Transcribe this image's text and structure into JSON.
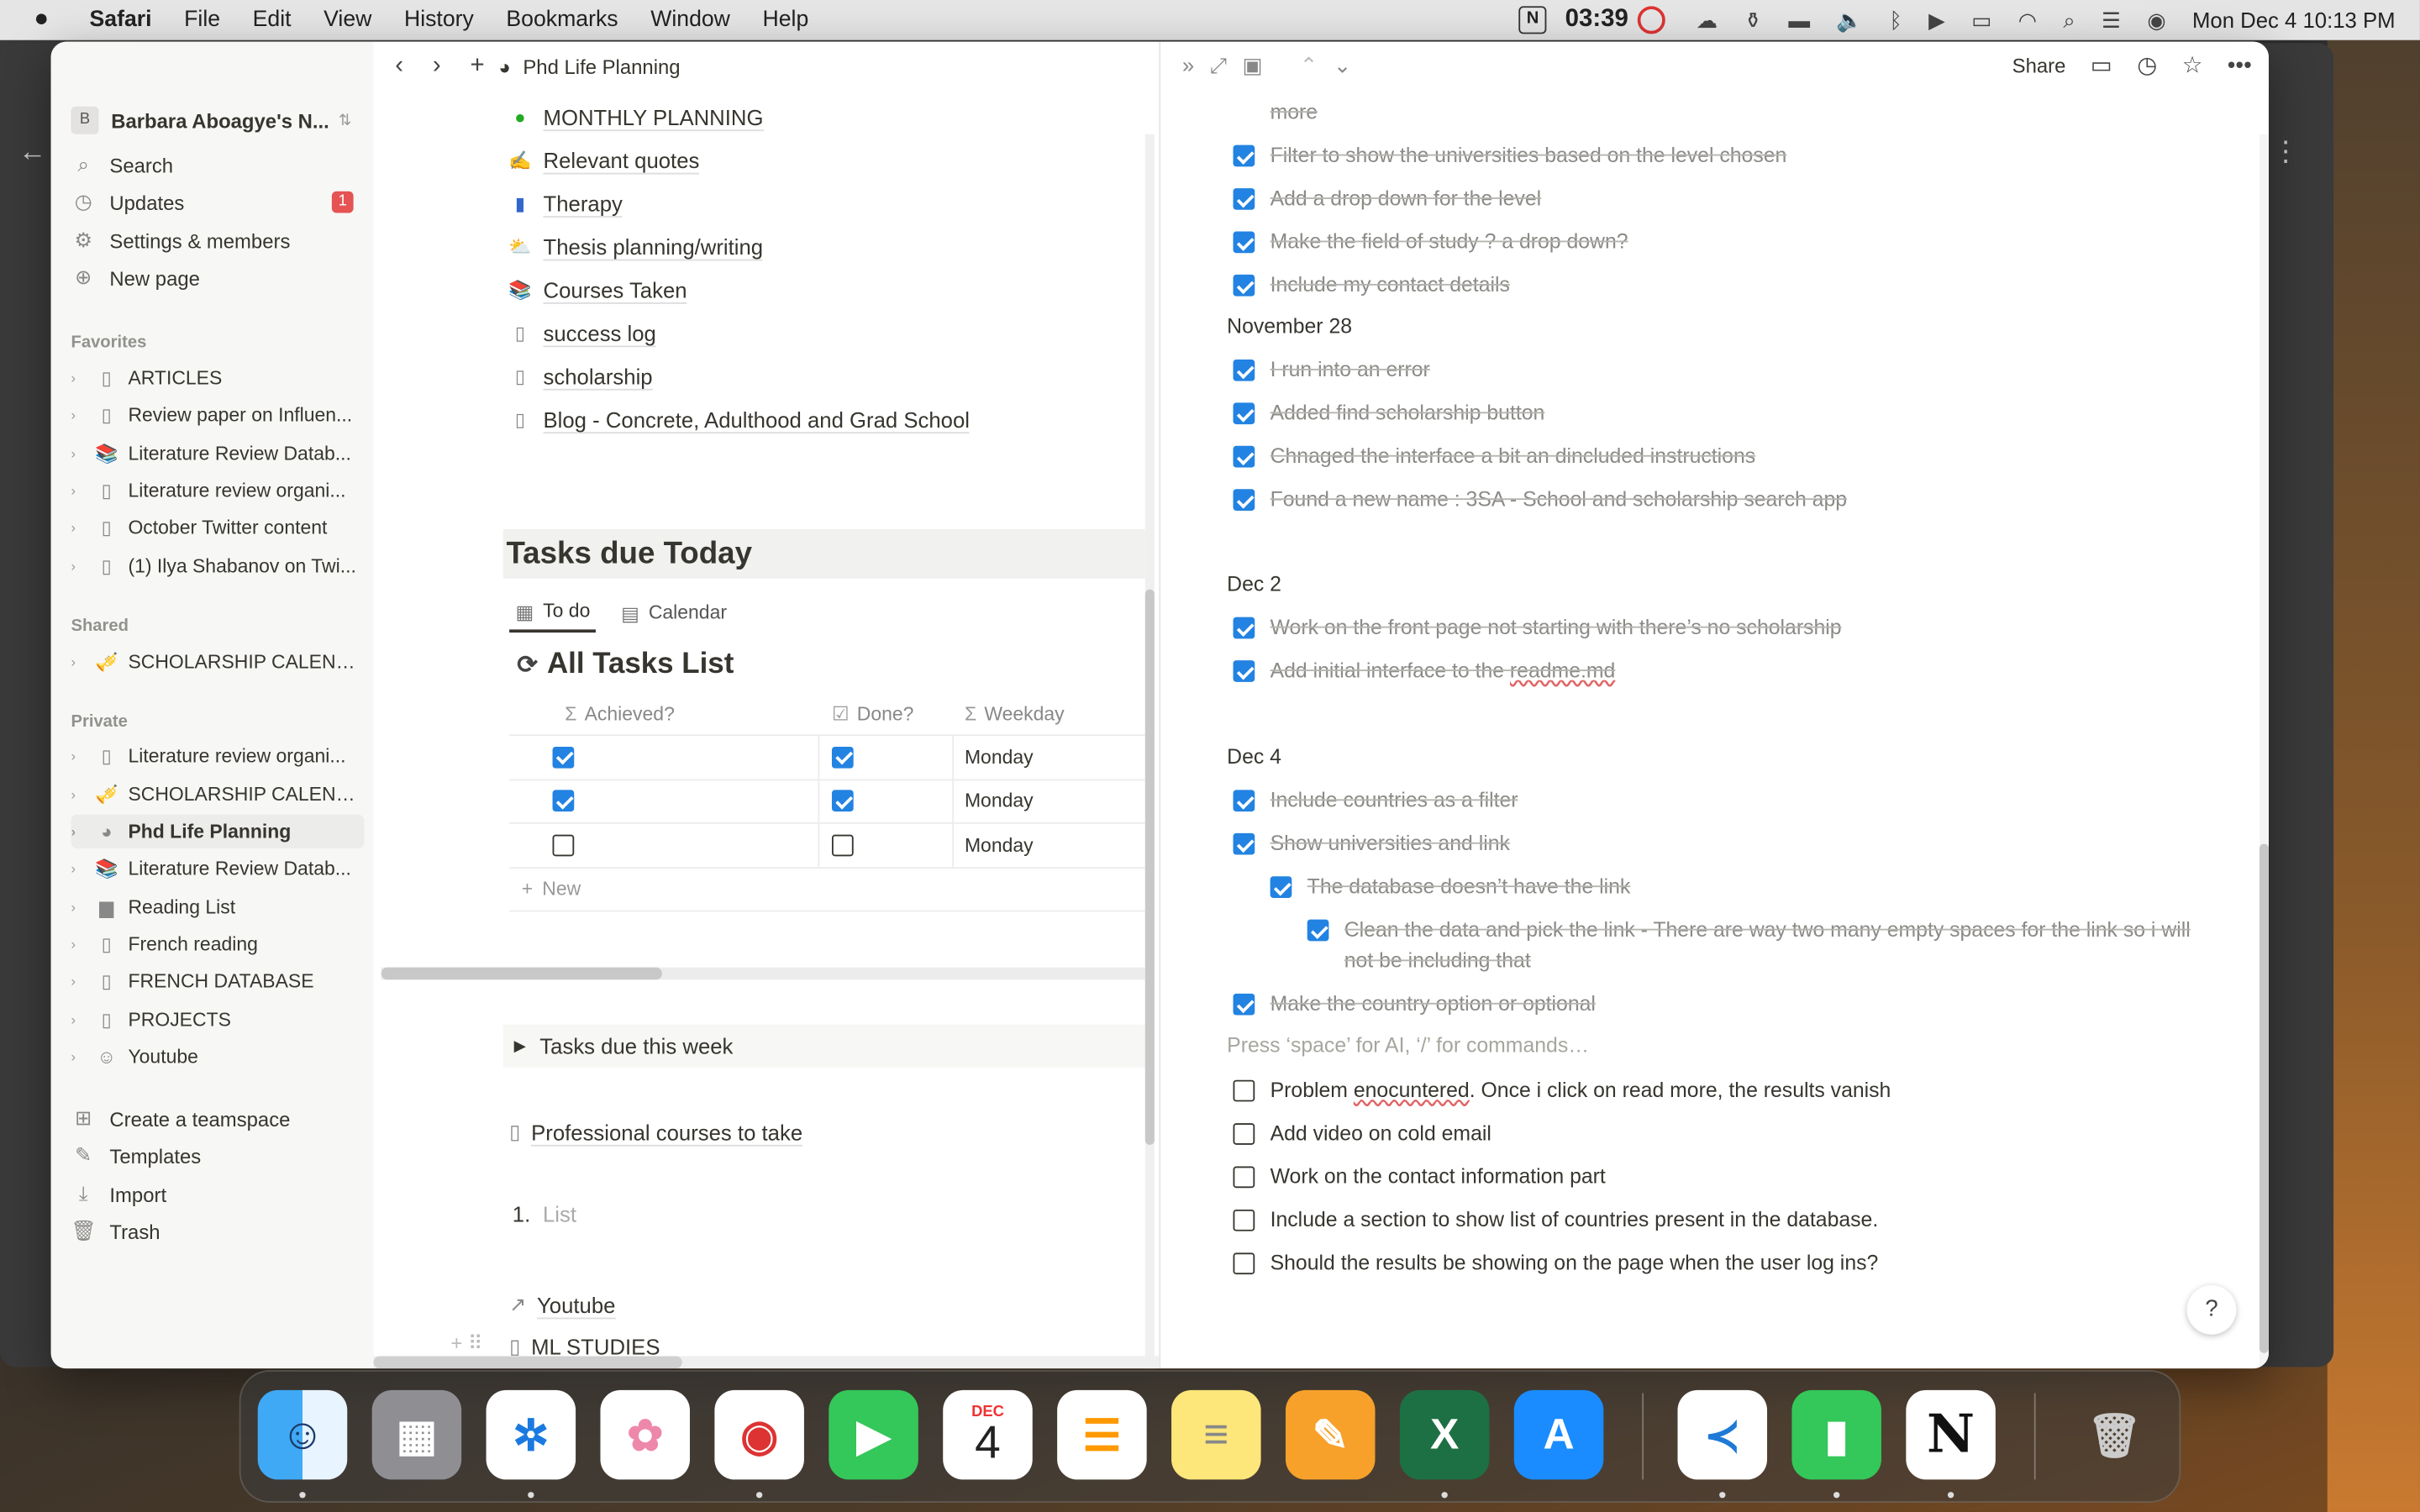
{
  "menubar": {
    "app": "Safari",
    "items": [
      "File",
      "Edit",
      "View",
      "History",
      "Bookmarks",
      "Window",
      "Help"
    ],
    "time": "03:39",
    "date": "Mon Dec 4  10:13 PM"
  },
  "sidebar": {
    "workspace": "Barbara Aboagye's N...",
    "workspace_initial": "B",
    "nav": [
      {
        "label": "Search",
        "icon": "search-icon"
      },
      {
        "label": "Updates",
        "icon": "clock-icon",
        "badge": "1"
      },
      {
        "label": "Settings & members",
        "icon": "gear-icon"
      },
      {
        "label": "New page",
        "icon": "plus-circle-icon"
      }
    ],
    "favorites_heading": "Favorites",
    "favorites": [
      "ARTICLES",
      "Review paper on Influen...",
      "Literature Review Datab...",
      "Literature review organi...",
      "October Twitter content",
      "(1) Ilya Shabanov on Twi..."
    ],
    "shared_heading": "Shared",
    "shared": [
      "SCHOLARSHIP CALEND..."
    ],
    "private_heading": "Private",
    "private": [
      "Literature review organi...",
      "SCHOLARSHIP CALEND...",
      "Phd Life Planning",
      "Literature Review Datab...",
      "Reading List",
      "French reading",
      "FRENCH DATABASE",
      "PROJECTS",
      "Youtube"
    ],
    "bottom": [
      {
        "label": "Create a teamspace",
        "icon": "teamspace-icon"
      },
      {
        "label": "Templates",
        "icon": "templates-icon"
      },
      {
        "label": "Import",
        "icon": "import-icon"
      },
      {
        "label": "Trash",
        "icon": "trash-icon"
      }
    ]
  },
  "left": {
    "page_title": "Phd Life Planning",
    "links": [
      "MONTHLY PLANNING",
      "Relevant quotes",
      "Therapy",
      "Thesis planning/writing",
      "Courses Taken",
      "success log",
      "scholarship",
      "Blog - Concrete, Adulthood and Grad School"
    ],
    "tasks_heading": "Tasks due Today",
    "tabs": [
      "To do",
      "Calendar"
    ],
    "db_title": "All Tasks List",
    "columns": [
      "Achieved?",
      "Done?",
      "Weekday"
    ],
    "rows": [
      {
        "achieved": true,
        "done": true,
        "weekday": "Monday"
      },
      {
        "achieved": true,
        "done": true,
        "weekday": "Monday"
      },
      {
        "achieved": false,
        "done": false,
        "weekday": "Monday"
      }
    ],
    "new_label": "New",
    "toggle": "Tasks due this week",
    "professional": "Professional courses to take",
    "list_number": "1.",
    "list_placeholder": "List",
    "youtube": "Youtube",
    "ml": "ML STUDIES"
  },
  "right": {
    "share": "Share",
    "top_cut": "more",
    "items_a": [
      "Filter to show the universities based on the level chosen",
      "Add a drop down for the level",
      "Make the field of study ? a drop down?",
      "Include my contact details"
    ],
    "date1": "November 28",
    "items_b": [
      "I run into an error",
      "Added find scholarship button",
      "Chnaged the interface a bit an dincluded instructions",
      "Found a new name : 3SA - School and scholarship search app"
    ],
    "date2": "Dec 2",
    "items_c1": "Work on the front page not starting with there’s no scholarship",
    "items_c2_prefix": "Add initial interface to the ",
    "items_c2_link": "readme.md",
    "date3": "Dec 4",
    "items_d": [
      "Include countries as a filter",
      "Show universities and link",
      "The database doesn’t have the link",
      "Clean the data and pick the link  - There are way two many empty spaces for the link so i will not be including that",
      "Make the country option or optional"
    ],
    "placeholder": "Press ‘space’ for AI, ‘/’ for commands…",
    "open_1_prefix": "Problem ",
    "open_1_word": "enocuntered",
    "open_1_suffix": ". Once i click on read more, the results vanish",
    "open": [
      "Add video on cold email",
      "Work on the contact information part",
      "Include a section to show list of countries present in the database.",
      "Should the results be showing on the page when the user log ins?"
    ],
    "help": "?"
  },
  "dock": {
    "calendar_month": "DEC",
    "calendar_day": "4",
    "apps": [
      "Finder",
      "Launchpad",
      "Safari",
      "Photos",
      "Chrome",
      "FaceTime",
      "Calendar",
      "Reminders",
      "Notes",
      "Pages",
      "Excel",
      "App Store",
      "VS Code",
      "Numbers",
      "Notion",
      "Trash"
    ]
  },
  "colors": {
    "accent": "#2383e2",
    "badge": "#e55353"
  }
}
